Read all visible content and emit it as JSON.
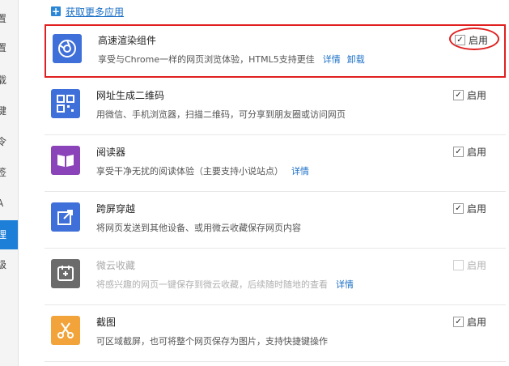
{
  "get_more": {
    "label": "获取更多应用"
  },
  "sidebar": {
    "items": [
      {
        "label": "置"
      },
      {
        "label": "置"
      },
      {
        "label": "载"
      },
      {
        "label": "键"
      },
      {
        "label": "令"
      },
      {
        "label": "签"
      },
      {
        "label": "A"
      },
      {
        "label": "理",
        "active": true
      },
      {
        "label": "级"
      }
    ]
  },
  "extensions": [
    {
      "name": "高速渲染组件",
      "desc": "享受与Chrome一样的网页浏览体验，HTML5支持更佳",
      "links": [
        "详情",
        "卸载"
      ],
      "enable_label": "启用",
      "enabled": true,
      "icon": "chrome-lens-icon",
      "icon_color": "#3f6fd8"
    },
    {
      "name": "网址生成二维码",
      "desc": "用微信、手机浏览器，扫描二维码，可分享到朋友圈或访问网页",
      "links": [],
      "enable_label": "启用",
      "enabled": true,
      "icon": "qrcode-icon",
      "icon_color": "#3f6fd8"
    },
    {
      "name": "阅读器",
      "desc": "享受干净无扰的阅读体验（主要支持小说站点）",
      "links": [
        "详情"
      ],
      "enable_label": "启用",
      "enabled": true,
      "icon": "book-icon",
      "icon_color": "#8a43b8"
    },
    {
      "name": "跨屏穿越",
      "desc": "将网页发送到其他设备、或用微云收藏保存网页内容",
      "links": [],
      "enable_label": "启用",
      "enabled": true,
      "icon": "share-icon",
      "icon_color": "#3f6fd8"
    },
    {
      "name": "微云收藏",
      "desc": "将感兴趣的网页一键保存到微云收藏，后续随时随地的查看",
      "links": [
        "详情"
      ],
      "enable_label": "启用",
      "enabled": false,
      "icon": "bookmark-icon",
      "icon_color": "#6b6b6b"
    },
    {
      "name": "截图",
      "desc": "可区域截屏，也可将整个网页保存为图片，支持快捷键操作",
      "links": [],
      "enable_label": "启用",
      "enabled": true,
      "icon": "scissors-icon",
      "icon_color": "#f2a33a"
    }
  ]
}
